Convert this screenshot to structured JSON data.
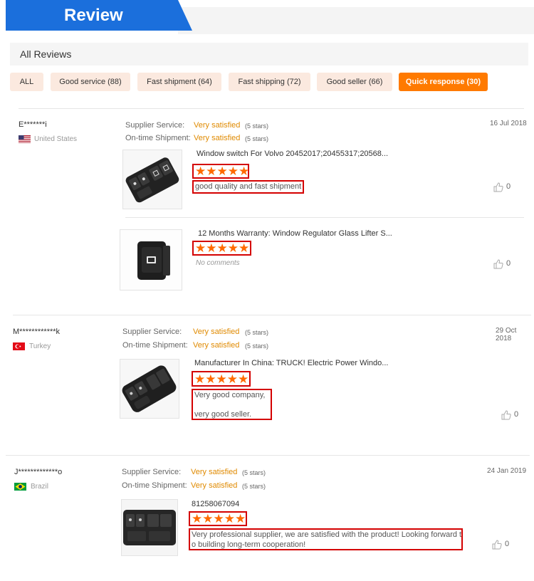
{
  "banner": {
    "title": "Review"
  },
  "all_reviews": {
    "title": "All Reviews"
  },
  "filters": [
    {
      "label": "ALL",
      "active": false
    },
    {
      "label": "Good service (88)",
      "active": false
    },
    {
      "label": "Fast shipment (64)",
      "active": false
    },
    {
      "label": "Fast shipping (72)",
      "active": false
    },
    {
      "label": "Good seller (66)",
      "active": false
    },
    {
      "label": "Quick response (30)",
      "active": true
    }
  ],
  "labels": {
    "supplier_service": "Supplier Service:",
    "ontime_shipment": "On-time Shipment:",
    "very_satisfied": "Very satisfied",
    "five_stars": "(5 stars)",
    "star_glyphs": "★★★★★",
    "no_comments": "No comments"
  },
  "reviews": [
    {
      "name": "E*******i",
      "country": "United States",
      "date": "16 Jul 2018",
      "items": [
        {
          "title": "Window switch For Volvo 20452017;20455317;20568...",
          "comment": "good quality and fast shipment",
          "likes": "0"
        },
        {
          "title": "12 Months Warranty: Window Regulator Glass Lifter S...",
          "comment": "",
          "likes": "0"
        }
      ]
    },
    {
      "name": "M************k",
      "country": "Turkey",
      "date": "29 Oct 2018",
      "items": [
        {
          "title": "Manufacturer In China: TRUCK! Electric Power Windo...",
          "comment_line1": "Very good company,",
          "comment_line2": "very good seller.",
          "likes": "0"
        }
      ]
    },
    {
      "name": "J*************o",
      "country": "Brazil",
      "date": "24 Jan 2019",
      "items": [
        {
          "title": "81258067094",
          "comment_line1": "Very professional supplier, we are satisfied with the product! Looking forward  t",
          "comment_line2": "o building long-term cooperation!",
          "likes": "0"
        }
      ]
    }
  ],
  "colors": {
    "accent": "#ff7a00",
    "banner": "#1b6fdc",
    "highlight": "#d40000",
    "star": "#ff6a00"
  }
}
